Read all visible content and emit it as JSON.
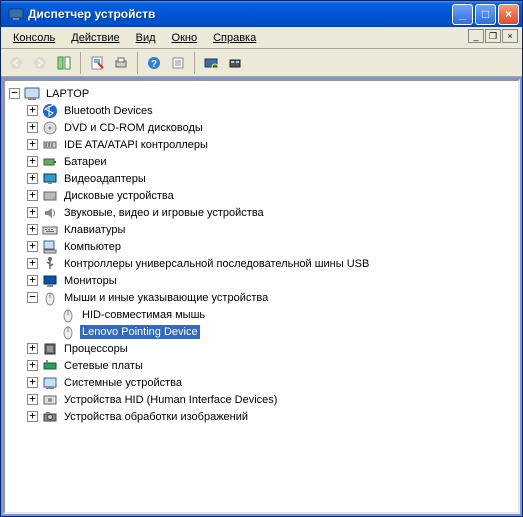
{
  "window": {
    "title": "Диспетчер устройств"
  },
  "menu": {
    "console": "Консоль",
    "action": "Действие",
    "view": "Вид",
    "window": "Окно",
    "help": "Справка"
  },
  "tree": {
    "root": "LAPTOP",
    "nodes": [
      {
        "label": "Bluetooth Devices",
        "icon": "bluetooth"
      },
      {
        "label": "DVD и CD-ROM дисководы",
        "icon": "cdrom"
      },
      {
        "label": "IDE ATA/ATAPI контроллеры",
        "icon": "ide"
      },
      {
        "label": "Батареи",
        "icon": "battery"
      },
      {
        "label": "Видеоадаптеры",
        "icon": "display"
      },
      {
        "label": "Дисковые устройства",
        "icon": "disk"
      },
      {
        "label": "Звуковые, видео и игровые устройства",
        "icon": "sound"
      },
      {
        "label": "Клавиатуры",
        "icon": "keyboard"
      },
      {
        "label": "Компьютер",
        "icon": "computer"
      },
      {
        "label": "Контроллеры универсальной последовательной шины USB",
        "icon": "usb"
      },
      {
        "label": "Мониторы",
        "icon": "monitor"
      },
      {
        "label": "Мыши и иные указывающие устройства",
        "icon": "mouse",
        "expanded": true,
        "children": [
          {
            "label": "HID-совместимая мышь",
            "icon": "mouse"
          },
          {
            "label": "Lenovo Pointing Device",
            "icon": "mouse",
            "selected": true
          }
        ]
      },
      {
        "label": "Процессоры",
        "icon": "cpu"
      },
      {
        "label": "Сетевые платы",
        "icon": "network"
      },
      {
        "label": "Системные устройства",
        "icon": "system"
      },
      {
        "label": "Устройства HID (Human Interface Devices)",
        "icon": "hid"
      },
      {
        "label": "Устройства обработки изображений",
        "icon": "imaging"
      }
    ]
  },
  "glyph": {
    "plus": "+",
    "minus": "−"
  }
}
